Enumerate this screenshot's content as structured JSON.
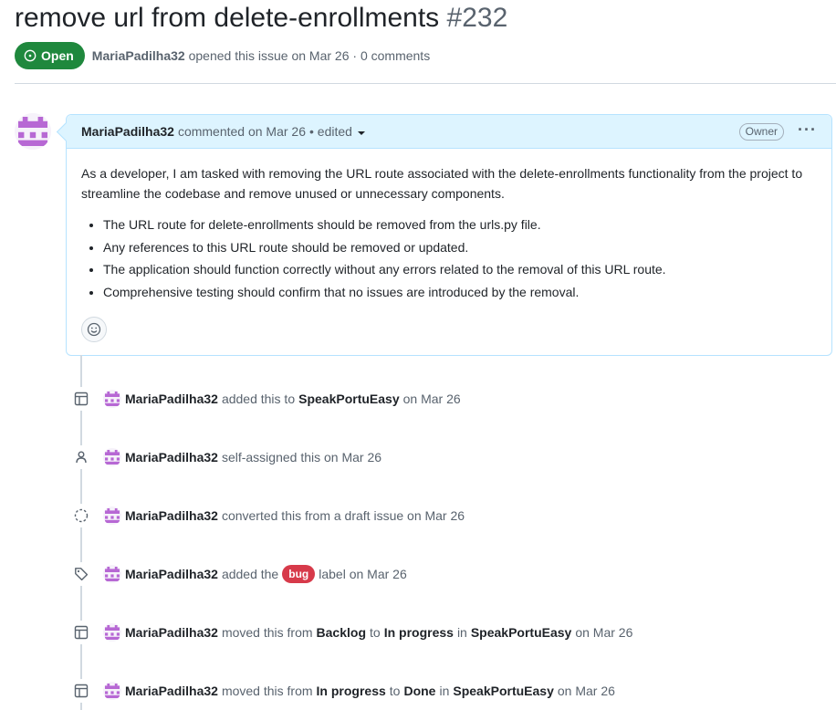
{
  "issue": {
    "title": "remove url from delete-enrollments",
    "number": "#232",
    "status": "Open",
    "author": "MariaPadilha32",
    "opened_text": "opened this issue on Mar 26 · 0 comments"
  },
  "comment": {
    "author": "MariaPadilha32",
    "meta": "commented on Mar 26",
    "edited": "• edited",
    "role_badge": "Owner",
    "menu": "···",
    "intro": "As a developer, I am tasked with removing the URL route associated with the delete-enrollments functionality from the project to streamline the codebase and remove unused or unnecessary components.",
    "bullets": [
      "The URL route for delete-enrollments should be removed from the urls.py file.",
      "Any references to this URL route should be removed or updated.",
      "The application should function correctly without any errors related to the removal of this URL route.",
      "Comprehensive testing should confirm that no issues are introduced by the removal."
    ]
  },
  "timeline": [
    {
      "actor": "MariaPadilha32",
      "t1": "added this to",
      "s1": "SpeakPortuEasy",
      "t2": "on Mar 26"
    },
    {
      "actor": "MariaPadilha32",
      "t1": "self-assigned this on Mar 26"
    },
    {
      "actor": "MariaPadilha32",
      "t1": "converted this from a draft issue on Mar 26"
    },
    {
      "actor": "MariaPadilha32",
      "t1": "added the",
      "label": "bug",
      "t2": "label on Mar 26"
    },
    {
      "actor": "MariaPadilha32",
      "t1": "moved this from",
      "s1": "Backlog",
      "t2": "to",
      "s2": "In progress",
      "t3": "in",
      "s3": "SpeakPortuEasy",
      "t4": "on Mar 26"
    },
    {
      "actor": "MariaPadilha32",
      "t1": "moved this from",
      "s1": "In progress",
      "t2": "to",
      "s2": "Done",
      "t3": "in",
      "s3": "SpeakPortuEasy",
      "t4": "on Mar 26"
    }
  ],
  "colors": {
    "open_green": "#1f883d",
    "bug_label": "#d73a4a",
    "comment_header": "#ddf4ff",
    "avatar_purple": "#b768d4"
  },
  "icons": {
    "status": "circle-dot-icon",
    "project": "table-icon",
    "assign": "person-icon",
    "convert": "dashed-circle-icon",
    "label": "tag-icon",
    "reaction": "smiley-icon"
  }
}
